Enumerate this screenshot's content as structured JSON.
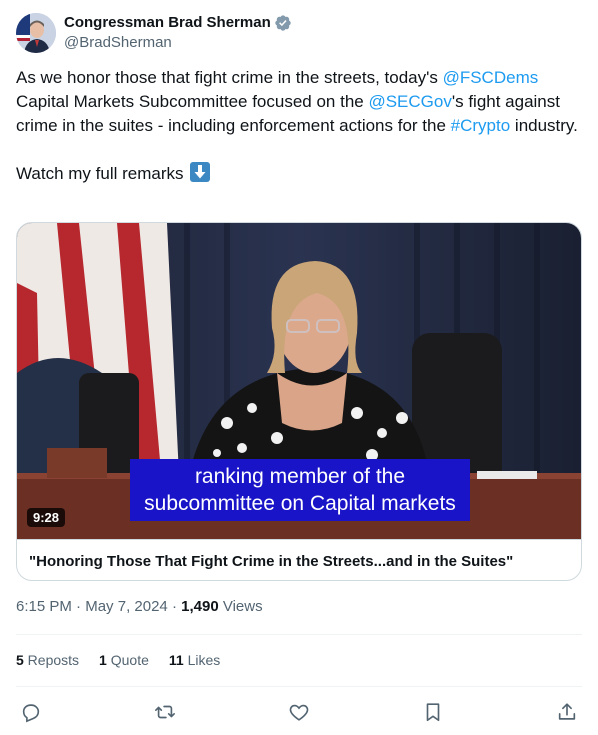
{
  "author": {
    "name": "Congressman Brad Sherman",
    "handle": "@BradSherman"
  },
  "tweet": {
    "text_1": "As we honor those that fight crime in the streets, today's ",
    "mention_1": "@FSCDems",
    "text_2": " Capital Markets Subcommittee focused on the ",
    "mention_2": "@SECGov",
    "text_3": "'s fight against crime in the suites - including enforcement actions for the ",
    "hashtag": "#Crypto",
    "text_4": " industry.",
    "watch_text": "Watch my full remarks "
  },
  "video": {
    "caption_line_1": "ranking member of the",
    "caption_line_2": "subcommittee on Capital markets",
    "duration": "9:28",
    "title": "\"Honoring Those That Fight Crime in the Streets...and in the Suites\""
  },
  "meta": {
    "time": "6:15 PM",
    "separator": " · ",
    "date": "May 7, 2024",
    "views_count": "1,490",
    "views_label": " Views"
  },
  "stats": {
    "reposts_count": "5",
    "reposts_label": " Reposts",
    "quotes_count": "1",
    "quotes_label": " Quote",
    "likes_count": "11",
    "likes_label": " Likes"
  },
  "colors": {
    "link": "#1d9bf0",
    "secondary_text": "#536471",
    "caption_bg": "#1a14c8"
  },
  "icons": [
    "verified-badge-icon",
    "down-arrow-emoji-icon",
    "reply-icon",
    "repost-icon",
    "like-icon",
    "bookmark-icon",
    "share-icon"
  ]
}
